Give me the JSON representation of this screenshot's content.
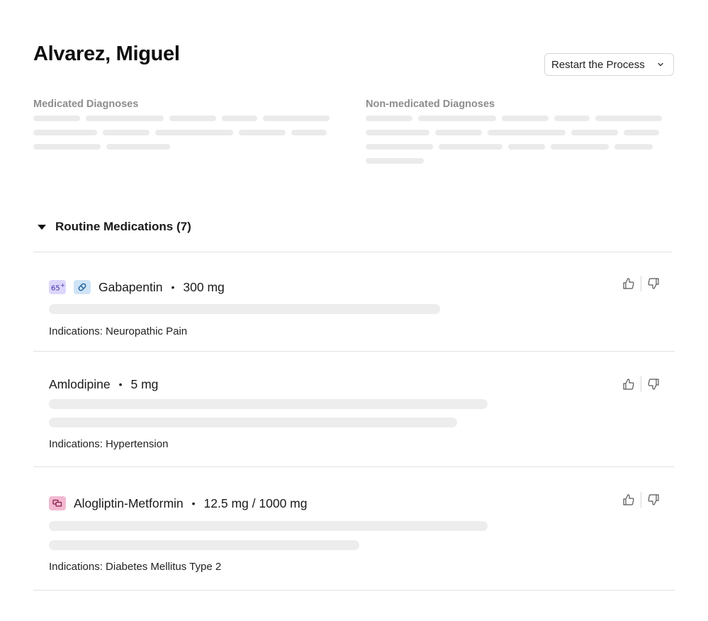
{
  "patient": {
    "name": "Alvarez, Miguel"
  },
  "toolbar": {
    "restart_label": "Restart the Process"
  },
  "diagnoses": {
    "medicated_heading": "Medicated Diagnoses",
    "non_medicated_heading": "Non-medicated Diagnoses"
  },
  "routine": {
    "title": "Routine Medications (7)"
  },
  "medications": [
    {
      "name": "Gabapentin",
      "dose": "300 mg",
      "indications": "Indications: Neuropathic Pain",
      "badges": [
        "age-65-plus-icon",
        "pill-icon"
      ]
    },
    {
      "name": "Amlodipine",
      "dose": "5 mg",
      "indications": "Indications: Hypertension",
      "badges": []
    },
    {
      "name": "Alogliptin-Metformin",
      "dose": "12.5 mg / 1000 mg",
      "indications": "Indications: Diabetes Mellitus Type 2",
      "badges": [
        "combination-icon"
      ]
    }
  ],
  "colors": {
    "skeleton": "#ebebeb",
    "age_badge": "#ddd6fb",
    "pill_badge": "#cfe4f7",
    "combo_badge": "#f2b9d1",
    "divider": "#e2e2e2"
  }
}
